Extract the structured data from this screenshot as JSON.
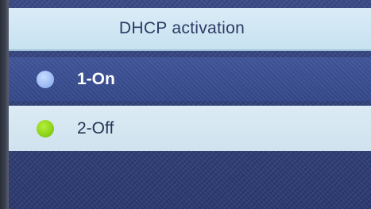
{
  "screen": {
    "title": "DHCP activation"
  },
  "menu": {
    "options": [
      {
        "label": "1-On",
        "selected": false,
        "indicator_color": "#9dbcf4"
      },
      {
        "label": "2-Off",
        "selected": true,
        "indicator_color": "#8ad318"
      }
    ]
  }
}
